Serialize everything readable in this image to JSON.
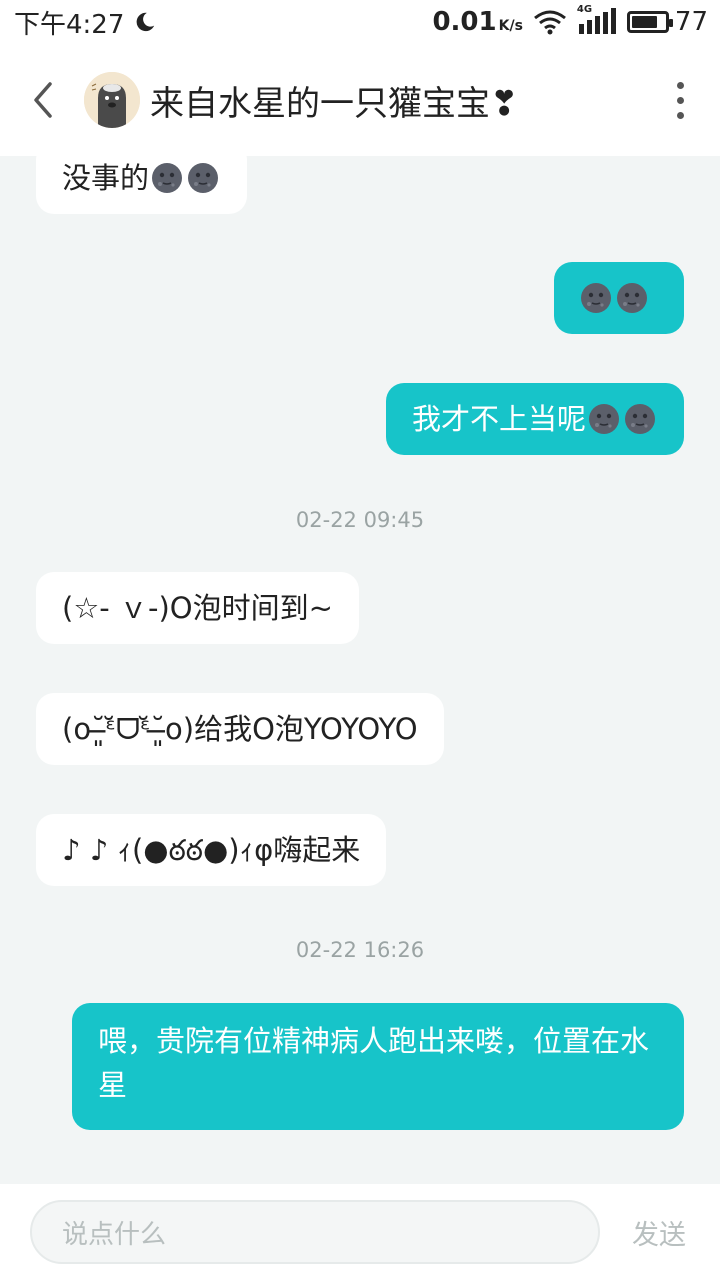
{
  "status_bar": {
    "time": "下午4:27",
    "net_speed": "0.01",
    "net_unit": "K/s",
    "network_type": "4G",
    "battery": "77",
    "battery_level_percent": 77
  },
  "header": {
    "title": "来自水星的一只獾宝宝❣"
  },
  "messages": [
    {
      "text": "没事的",
      "emoji_count": 2,
      "emoji": "new-moon-face"
    },
    {
      "text": "",
      "emoji_count": 2,
      "emoji": "new-moon-face"
    },
    {
      "text": "我才不上当呢",
      "emoji_count": 2,
      "emoji": "new-moon-face"
    },
    {
      "text": "(☆- ｖ-)O泡时间到~"
    },
    {
      "text": "(o˘̶͈ᵋ̆ᗜᵋ̆˘̶͈o)给我O泡YOYOYO"
    },
    {
      "text": "♪ ♪ ｨ(●ఠఠ●)ｨφ嗨起来"
    },
    {
      "text": "喂，贵院有位精神病人跑出来喽，位置在水星"
    }
  ],
  "timestamps": [
    "02-22 09:45",
    "02-22 16:26"
  ],
  "input": {
    "placeholder": "说点什么",
    "send_label": "发送"
  },
  "colors": {
    "outgoing_bubble": "#17c4c9",
    "incoming_bubble": "#ffffff",
    "background": "#f2f5f5"
  }
}
